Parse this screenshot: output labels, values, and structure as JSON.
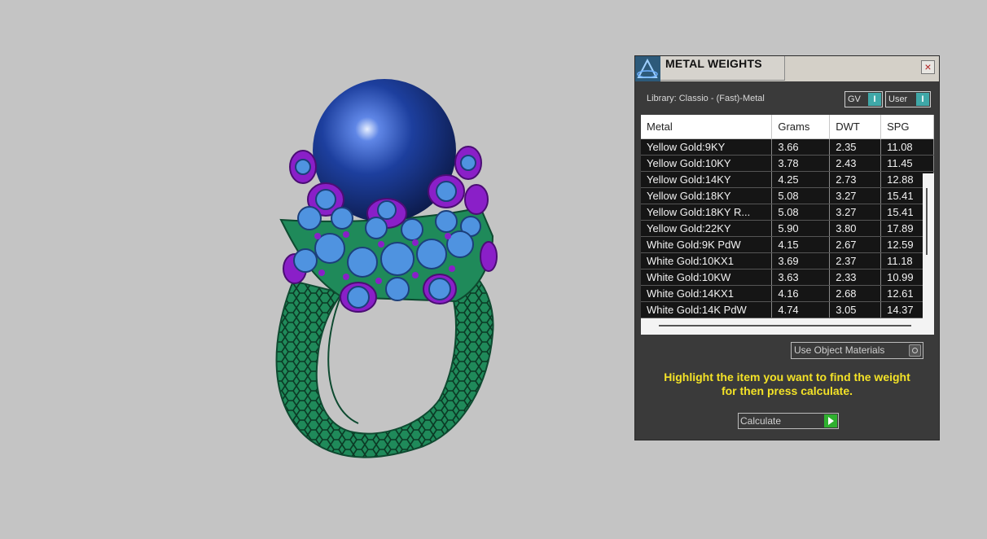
{
  "panel": {
    "title": "METAL WEIGHTS",
    "close_glyph": "×",
    "library_label": "Library: Classio - (Fast)-Metal",
    "gv_label": "GV",
    "user_label": "User",
    "toggle_glyph": "I",
    "use_object_materials_label": "Use Object Materials",
    "hint_line1": "Highlight the item you want to find the weight",
    "hint_line2": "for then press calculate.",
    "calculate_label": "Calculate",
    "table": {
      "headers": [
        "Metal",
        "Grams",
        "DWT",
        "SPG"
      ],
      "rows": [
        [
          "Yellow Gold:9KY",
          "3.66",
          "2.35",
          "11.08"
        ],
        [
          "Yellow Gold:10KY",
          "3.78",
          "2.43",
          "11.45"
        ],
        [
          "Yellow Gold:14KY",
          "4.25",
          "2.73",
          "12.88"
        ],
        [
          "Yellow Gold:18KY",
          "5.08",
          "3.27",
          "15.41"
        ],
        [
          "Yellow Gold:18KY R...",
          "5.08",
          "3.27",
          "15.41"
        ],
        [
          "Yellow Gold:22KY",
          "5.90",
          "3.80",
          "17.89"
        ],
        [
          "White Gold:9K PdW",
          "4.15",
          "2.67",
          "12.59"
        ],
        [
          "White Gold:10KX1",
          "3.69",
          "2.37",
          "11.18"
        ],
        [
          "White Gold:10KW",
          "3.63",
          "2.33",
          "10.99"
        ],
        [
          "White Gold:14KX1",
          "4.16",
          "2.68",
          "12.61"
        ],
        [
          "White Gold:14K PdW",
          "4.74",
          "3.05",
          "14.37"
        ]
      ]
    }
  },
  "viewport": {
    "model": "ring-3d-model",
    "colors": {
      "background": "#c4c4c4",
      "shank": "#1f8a5a",
      "pearl": "#1d3f9e",
      "prongs": "#8a1fc8",
      "stones": "#4f93e0"
    }
  },
  "icons": {
    "logo": "app-logo-icon",
    "close": "close-icon",
    "calculate": "play-arrow-icon"
  }
}
